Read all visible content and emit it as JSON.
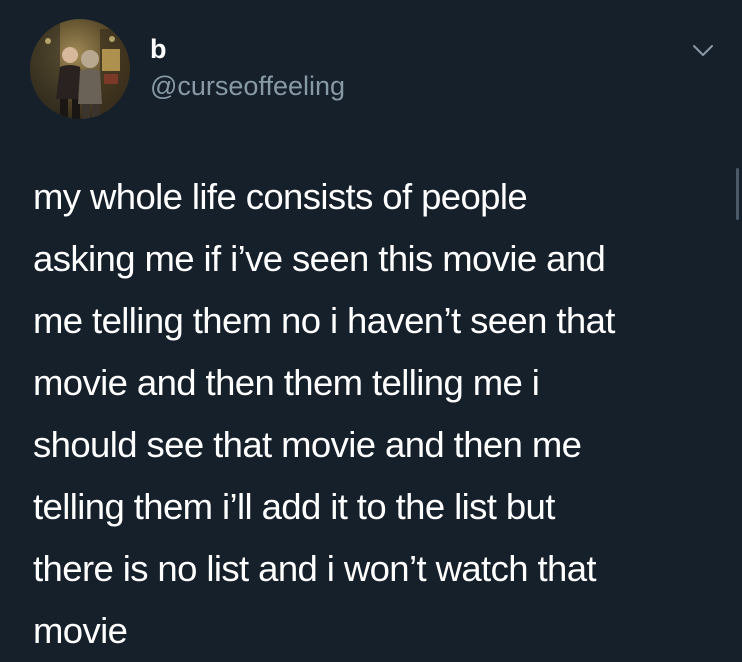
{
  "author": {
    "display_name": "b",
    "handle": "@curseoffeeling"
  },
  "tweet": {
    "lines": [
      "my whole life consists of people",
      "asking me if i’ve seen this movie and",
      "me telling them no i haven’t seen that",
      "movie and then them telling me i",
      "should see that movie and then me",
      "telling them i’ll add it to the list but",
      "there is no list and i won’t watch that",
      "movie"
    ]
  },
  "icons": {
    "menu": "chevron-down-icon"
  },
  "colors": {
    "background": "#15202b",
    "primary_text": "#ffffff",
    "secondary_text": "#8899a6"
  }
}
